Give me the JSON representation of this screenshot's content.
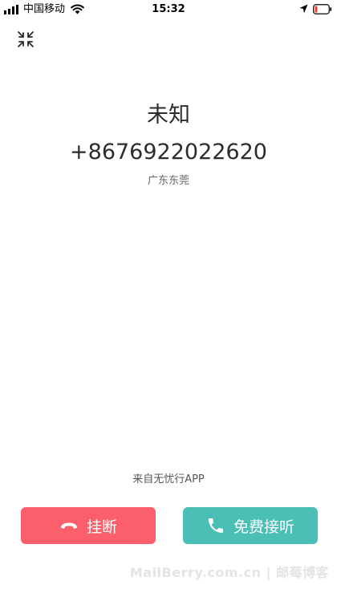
{
  "status_bar": {
    "carrier": "中国移动",
    "time": "15:32",
    "signal_icon": "signal-bars-icon",
    "wifi_icon": "wifi-icon",
    "location_icon": "location-arrow-icon",
    "battery_icon": "battery-low-icon",
    "battery_color": "#ff3b30"
  },
  "toolbar": {
    "minimize_icon": "minimize-icon"
  },
  "caller": {
    "name": "未知",
    "number": "+8676922022620",
    "location": "广东东莞"
  },
  "source": {
    "label": "来自无忧行APP"
  },
  "actions": {
    "hangup": {
      "label": "挂断",
      "icon": "phone-hangup-icon",
      "color": "#fa5f6b"
    },
    "answer": {
      "label": "免费接听",
      "icon": "phone-icon",
      "color": "#4bbfb5"
    }
  },
  "watermark": {
    "text": "MailBerry.com.cn | 邮莓博客"
  }
}
